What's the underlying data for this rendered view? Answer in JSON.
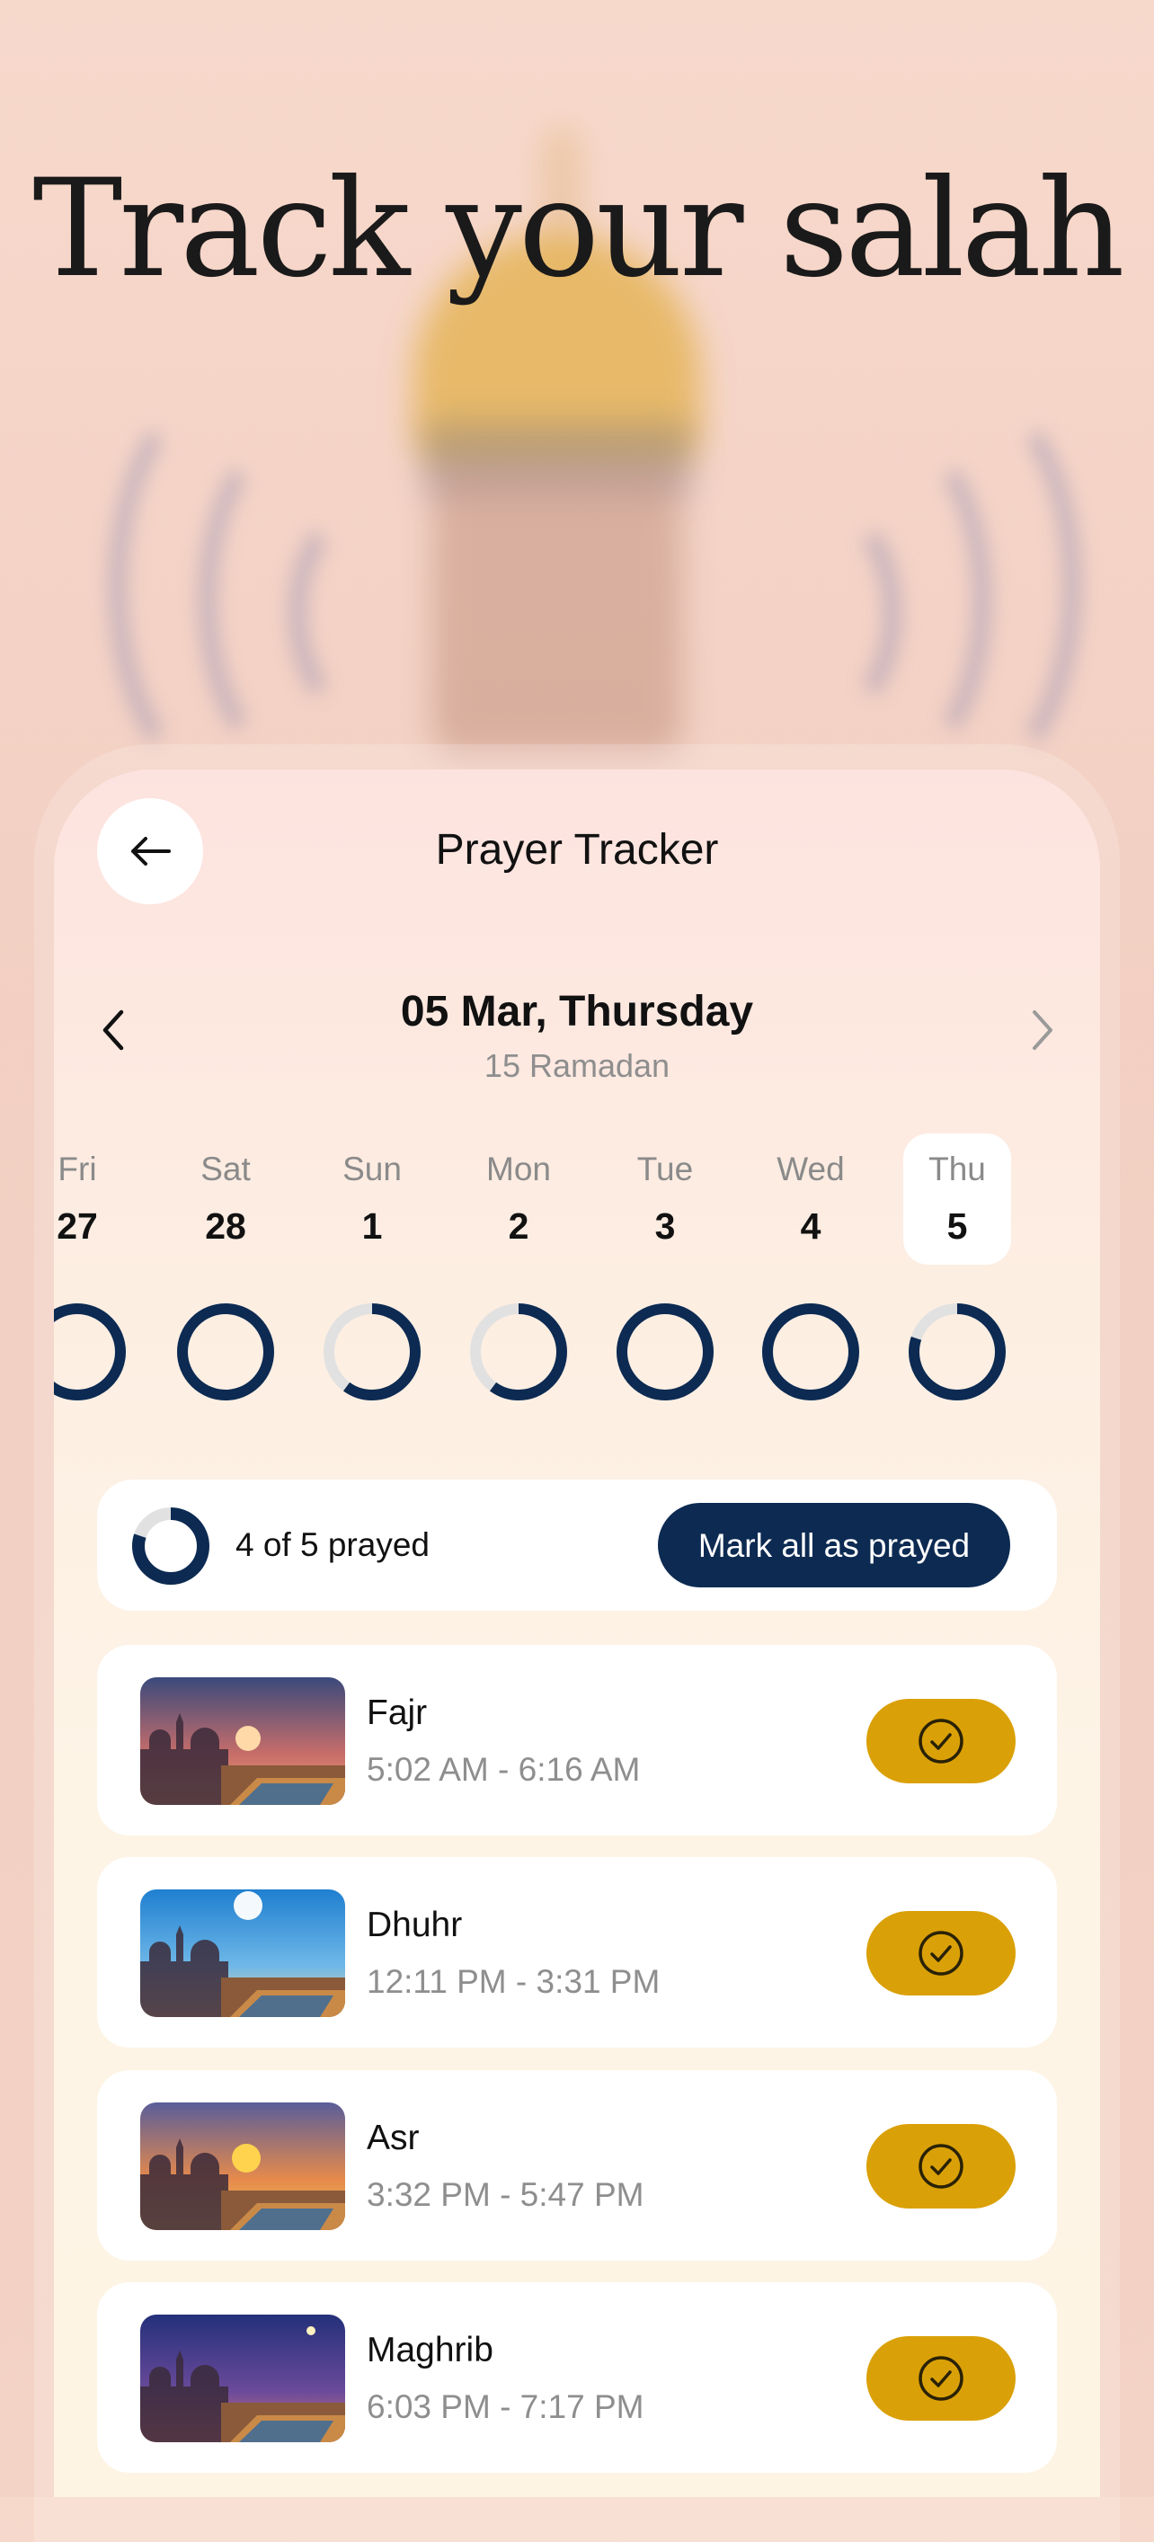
{
  "hero": {
    "title": "Track your salah"
  },
  "header": {
    "title": "Prayer Tracker",
    "back_icon": "arrow-left-icon"
  },
  "date": {
    "main": "05 Mar, Thursday",
    "sub": "15 Ramadan",
    "prev_icon": "chevron-left-icon",
    "next_icon": "chevron-right-icon"
  },
  "days": [
    {
      "name": "Fri",
      "num": "27",
      "progress": 1.0
    },
    {
      "name": "Sat",
      "num": "28",
      "progress": 1.0
    },
    {
      "name": "Sun",
      "num": "1",
      "progress": 0.6
    },
    {
      "name": "Mon",
      "num": "2",
      "progress": 0.6
    },
    {
      "name": "Tue",
      "num": "3",
      "progress": 1.0
    },
    {
      "name": "Wed",
      "num": "4",
      "progress": 1.0
    },
    {
      "name": "Thu",
      "num": "5",
      "progress": 0.8,
      "selected": true
    }
  ],
  "summary": {
    "text": "4 of 5 prayed",
    "progress": 0.8,
    "button": "Mark all as prayed"
  },
  "prayers": [
    {
      "name": "Fajr",
      "time": "5:02 AM - 6:16 AM",
      "scene": "dawn",
      "done": true
    },
    {
      "name": "Dhuhr",
      "time": "12:11 PM - 3:31 PM",
      "scene": "noon",
      "done": true
    },
    {
      "name": "Asr",
      "time": "3:32 PM - 5:47 PM",
      "scene": "afternoon",
      "done": true
    },
    {
      "name": "Maghrib",
      "time": "6:03 PM - 7:17 PM",
      "scene": "dusk",
      "done": true
    }
  ],
  "colors": {
    "navy": "#0c2a52",
    "gold": "#daa007",
    "track": "#e1e1e1"
  },
  "check_icon": "check-circle-icon"
}
